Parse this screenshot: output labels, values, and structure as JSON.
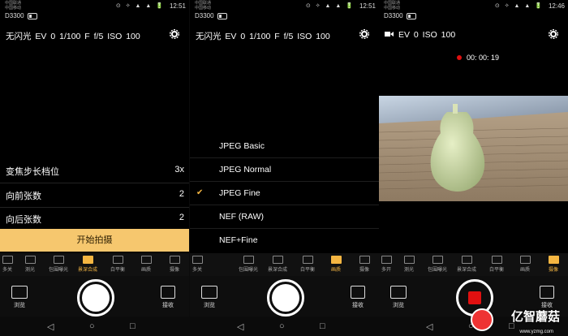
{
  "panels": [
    {
      "status": {
        "carrier": "中国联通\n中国移动",
        "icons": "⊙ ✧ ▲ ▲ 🔋",
        "time": "12:51"
      },
      "device": "D3300",
      "params": "无闪光  EV 0  1/100  F f/5  ISO 100",
      "options": [
        {
          "label": "变焦步长档位",
          "value": "3x"
        },
        {
          "label": "向前张数",
          "value": "2"
        },
        {
          "label": "向后张数",
          "value": "2"
        }
      ],
      "start_label": "开始拍摄",
      "modes": [
        "多关",
        "测光",
        "包围曝光",
        "景深合成",
        "白平衡",
        "画质",
        "摄像"
      ],
      "active_mode": 3,
      "browse_label": "浏览",
      "receive_label": "接收"
    },
    {
      "status": {
        "carrier": "中国联通\n中国移动",
        "icons": "⊙ ✧ ▲ ▲ 🔋",
        "time": "12:51"
      },
      "device": "D3300",
      "params": "无闪光  EV 0  1/100  F f/5  ISO 100",
      "formats": [
        "JPEG Basic",
        "JPEG Normal",
        "JPEG Fine",
        "NEF (RAW)",
        "NEF+Fine"
      ],
      "selected_format": 2,
      "modes": [
        "多关",
        "包围曝光",
        "景深合成",
        "白平衡",
        "画质",
        "摄像"
      ],
      "active_mode": 4,
      "browse_label": "浏览",
      "receive_label": "接收"
    },
    {
      "status": {
        "carrier": "中国联通\n中国移动",
        "icons": "⊙ ✧ ▲ ▲ 🔋",
        "time": "12:46"
      },
      "device": "D3300",
      "params": "EV 0  ISO 100",
      "rec_time": "00: 00: 19",
      "modes": [
        "多开",
        "测光",
        "包围曝光",
        "景深合成",
        "白平衡",
        "画质",
        "摄像"
      ],
      "active_mode": 6,
      "browse_label": "浏览",
      "receive_label": "接收",
      "watermark": "亿智蘑菇",
      "watermark_url": "www.yzmg.com"
    }
  ],
  "nav": {
    "back": "◁",
    "home": "○",
    "recent": "□"
  },
  "colors": {
    "accent": "#f5b642",
    "start_button": "#f6c76e",
    "record": "#e01010"
  }
}
